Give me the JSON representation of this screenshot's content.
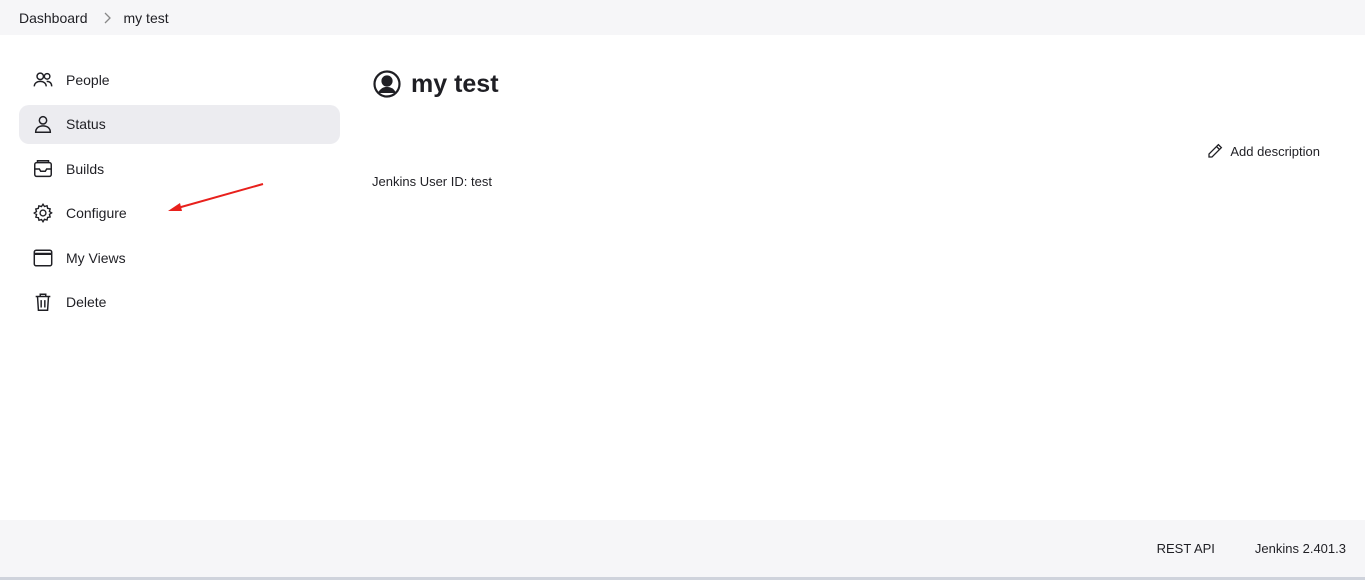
{
  "breadcrumb": {
    "items": [
      "Dashboard",
      "my test"
    ],
    "separator_icon": "chevron-right-icon"
  },
  "sidebar": {
    "items": [
      {
        "label": "People",
        "icon": "people-icon",
        "active": false
      },
      {
        "label": "Status",
        "icon": "person-icon",
        "active": true
      },
      {
        "label": "Builds",
        "icon": "builds-icon",
        "active": false
      },
      {
        "label": "Configure",
        "icon": "gear-icon",
        "active": false
      },
      {
        "label": "My Views",
        "icon": "window-icon",
        "active": false
      },
      {
        "label": "Delete",
        "icon": "trash-icon",
        "active": false
      }
    ]
  },
  "main": {
    "title": "my test",
    "title_icon": "user-circle-icon",
    "add_description_label": "Add description",
    "user_id_text": "Jenkins User ID: test"
  },
  "footer": {
    "rest_api_label": "REST API",
    "version_label": "Jenkins 2.401.3"
  },
  "colors": {
    "active_bg": "#ececf0",
    "bar_bg": "#f6f6f8",
    "annotation_arrow": "#e8201c"
  }
}
